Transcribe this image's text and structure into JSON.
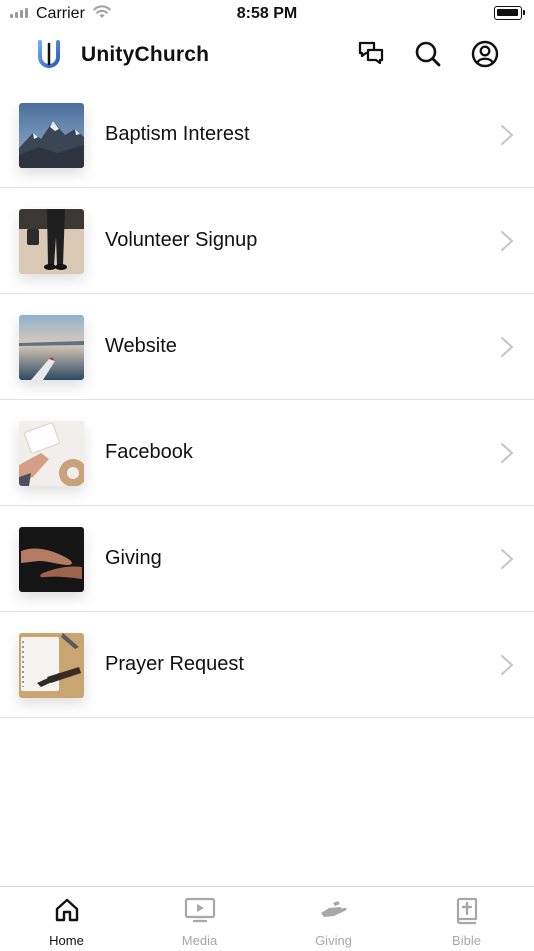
{
  "status_bar": {
    "carrier": "Carrier",
    "time": "8:58 PM"
  },
  "header": {
    "title": "UnityChurch"
  },
  "list": [
    {
      "label": "Baptism Interest"
    },
    {
      "label": "Volunteer Signup"
    },
    {
      "label": "Website"
    },
    {
      "label": "Facebook"
    },
    {
      "label": "Giving"
    },
    {
      "label": "Prayer Request"
    }
  ],
  "tabs": [
    {
      "label": "Home",
      "icon": "home-icon",
      "active": true
    },
    {
      "label": "Media",
      "icon": "media-icon",
      "active": false
    },
    {
      "label": "Giving",
      "icon": "giving-icon",
      "active": false
    },
    {
      "label": "Bible",
      "icon": "bible-icon",
      "active": false
    }
  ],
  "colors": {
    "accent": "#3a7bd5",
    "inactive": "#a8a8a8",
    "divider": "#e2e2e2"
  }
}
